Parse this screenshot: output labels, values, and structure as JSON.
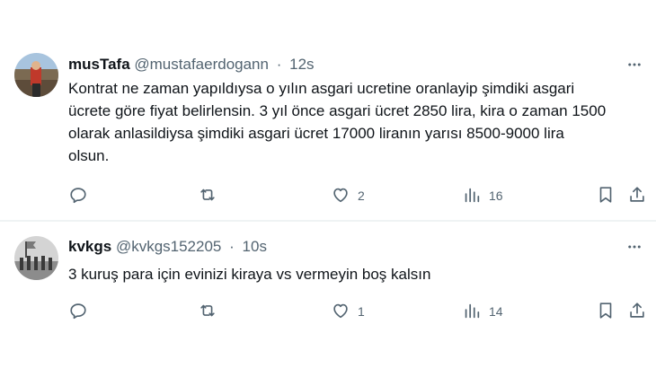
{
  "tweets": [
    {
      "display_name": "musTafa",
      "handle": "@mustafaerdogann",
      "separator": "·",
      "time": "12s",
      "text": "Kontrat ne zaman yapıldıysa o yılın asgari ucretine oranlayip şimdiki asgari ücrete göre fiyat belirlensin. 3 yıl önce asgari ücret 2850 lira, kira o zaman 1500 olarak anlasildiysa şimdiki asgari ücret  17000 liranın yarısı 8500-9000 lira olsun.",
      "likes": "2",
      "views": "16"
    },
    {
      "display_name": "kvkgs",
      "handle": "@kvkgs152205",
      "separator": "·",
      "time": "10s",
      "text": "3 kuruş para için evinizi kiraya vs vermeyin boş kalsın",
      "likes": "1",
      "views": "14"
    }
  ],
  "icons": {
    "more": "more-horizontal-icon",
    "reply": "reply-icon",
    "retweet": "retweet-icon",
    "like": "heart-icon",
    "views": "views-chart-icon",
    "bookmark": "bookmark-icon",
    "share": "share-icon"
  },
  "colors": {
    "text": "#0f1419",
    "secondary": "#536471",
    "divider": "#eff3f4"
  }
}
